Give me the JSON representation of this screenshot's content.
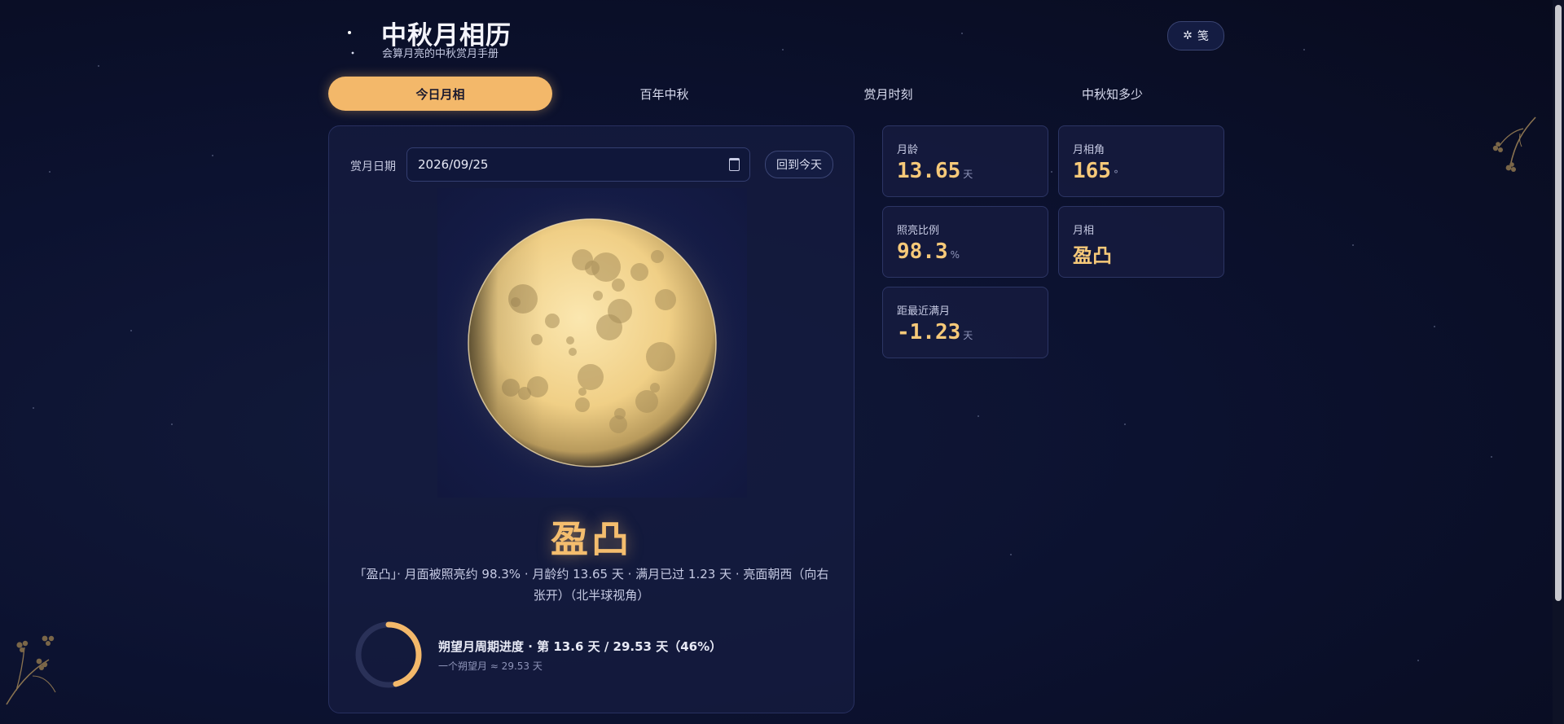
{
  "header": {
    "title": "中秋月相历",
    "subtitle": "会算月亮的中秋赏月手册",
    "lamp_button": "笺"
  },
  "tabs": [
    {
      "label": "今日月相",
      "active": true
    },
    {
      "label": "百年中秋",
      "active": false
    },
    {
      "label": "赏月时刻",
      "active": false
    },
    {
      "label": "中秋知多少",
      "active": false
    }
  ],
  "date_picker": {
    "label": "赏月日期",
    "value": "2026/09/25",
    "today_button": "回到今天"
  },
  "phase": {
    "name": "盈凸",
    "description": "「盈凸」· 月面被照亮约 98.3% · 月龄约 13.65 天 · 满月已过 1.23 天 · 亮面朝西（向右张开）（北半球视角）"
  },
  "cycle": {
    "title": "朔望月周期进度 · 第 13.6 天 / 29.53 天（46%）",
    "note": "一个朔望月 ≈ 29.53 天",
    "progress": 0.46
  },
  "stats": {
    "moon_age": {
      "label": "月龄",
      "value": "13.65",
      "unit": "天"
    },
    "phase_angle": {
      "label": "月相角",
      "value": "165",
      "unit": "°"
    },
    "illumination": {
      "label": "照亮比例",
      "value": "98.3",
      "unit": "%"
    },
    "phase": {
      "label": "月相",
      "value": "盈凸"
    },
    "nearest_full": {
      "label": "距最近满月",
      "value": "-1.23",
      "unit": "天"
    }
  },
  "colors": {
    "accent": "#f3b86a",
    "value": "#f6c979",
    "background": "#0c1230"
  }
}
